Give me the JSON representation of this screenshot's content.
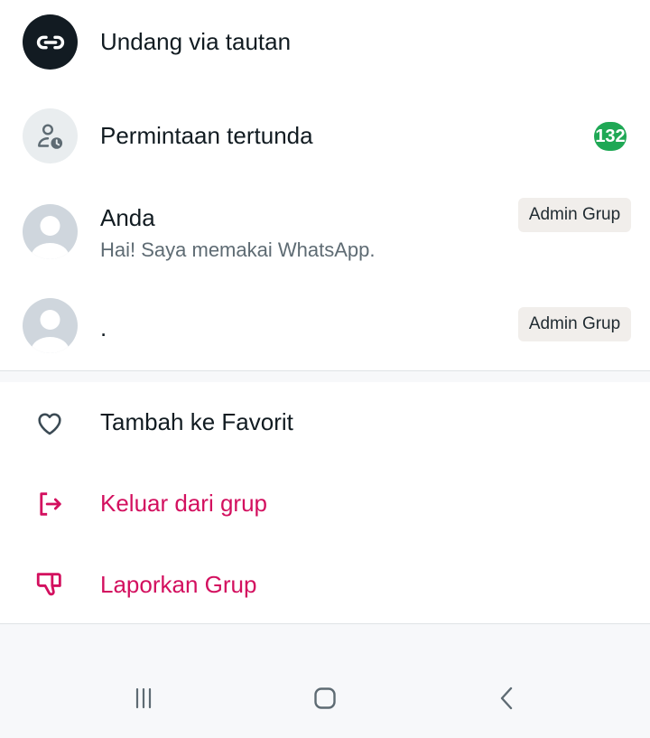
{
  "invite": {
    "label": "Undang via tautan",
    "icon": "link-icon"
  },
  "pending": {
    "label": "Permintaan tertunda",
    "count": "132",
    "icon": "person-clock-icon",
    "count_color": "#1fa855"
  },
  "participants": [
    {
      "name": "Anda",
      "status": "Hai! Saya memakai WhatsApp.",
      "role": "Admin Grup"
    },
    {
      "name": ".",
      "status": "",
      "role": "Admin Grup"
    }
  ],
  "actions": {
    "favorite": {
      "label": "Tambah ke Favorit",
      "icon": "heart-outline-icon"
    },
    "exit": {
      "label": "Keluar dari grup",
      "icon": "logout-icon",
      "color": "#d3105f"
    },
    "report": {
      "label": "Laporkan Grup",
      "icon": "thumbs-down-icon",
      "color": "#d3105f"
    }
  },
  "system_nav": {
    "recents": "recents-icon",
    "home": "home-icon",
    "back": "back-icon"
  }
}
